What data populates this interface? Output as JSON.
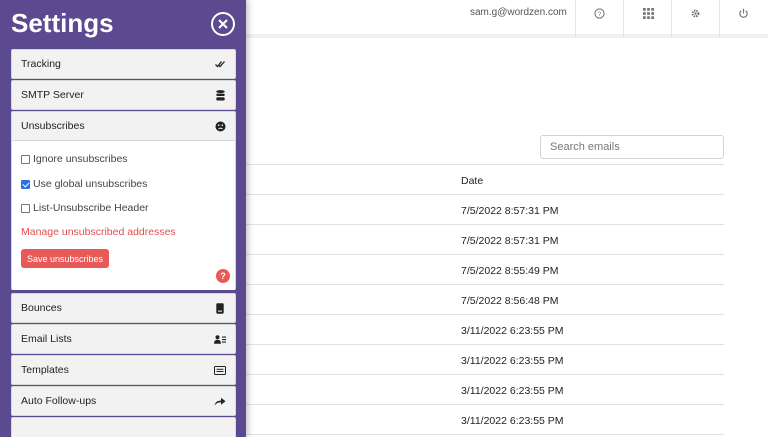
{
  "header": {
    "user_email": "sam.g@wordzen.com",
    "icons": [
      "help-circle-icon",
      "grid-icon",
      "gear-icon",
      "power-icon"
    ]
  },
  "search": {
    "placeholder": "Search emails",
    "value": ""
  },
  "table": {
    "date_header": "Date",
    "rows": [
      "7/5/2022 8:57:31 PM",
      "7/5/2022 8:57:31 PM",
      "7/5/2022 8:55:49 PM",
      "7/5/2022 8:56:48 PM",
      "3/11/2022 6:23:55 PM",
      "3/11/2022 6:23:55 PM",
      "3/11/2022 6:23:55 PM",
      "3/11/2022 6:23:55 PM"
    ]
  },
  "settings": {
    "title": "Settings",
    "sections": {
      "tracking": "Tracking",
      "smtp": "SMTP Server",
      "unsubscribes": "Unsubscribes",
      "bounces": "Bounces",
      "email_lists": "Email Lists",
      "templates": "Templates",
      "auto_followups": "Auto Follow-ups"
    },
    "unsubscribes": {
      "ignore_label": "Ignore unsubscribes",
      "ignore_checked": false,
      "global_label": "Use global unsubscribes",
      "global_checked": true,
      "header_label": "List-Unsubscribe Header",
      "header_checked": false,
      "manage_link": "Manage unsubscribed addresses",
      "save_button": "Save unsubscribes",
      "help": "?"
    }
  },
  "colors": {
    "panel": "#5b4a8f",
    "accent_red": "#e85a58",
    "checkbox_blue": "#2b74e0"
  }
}
